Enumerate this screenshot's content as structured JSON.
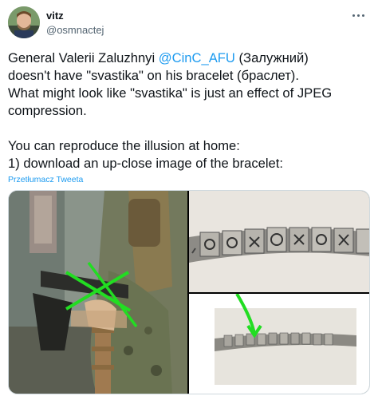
{
  "author": {
    "name": "vitz",
    "handle": "@osmnactej"
  },
  "tweet": {
    "line1_pre": "General Valerii Zaluzhnyi ",
    "mention": "@CinC_AFU",
    "line1_post": " (Залужний)",
    "line2": "doesn't have \"svastika\" on his bracelet (браслет).",
    "line3": "What might look like \"svastika\" is just an effect of JPEG",
    "line4": "compression.",
    "line5": "You can reproduce the illusion at home:",
    "line6": "1) download an up-close image of the bracelet:"
  },
  "translate_label": "Przetłumacz Tweeta",
  "icons": {
    "more": "more-horizontal-icon"
  },
  "colors": {
    "link": "#1d9bf0",
    "text": "#0f1419",
    "secondary": "#536471",
    "annotation_green": "#22dd22"
  },
  "media": {
    "count": 3
  }
}
